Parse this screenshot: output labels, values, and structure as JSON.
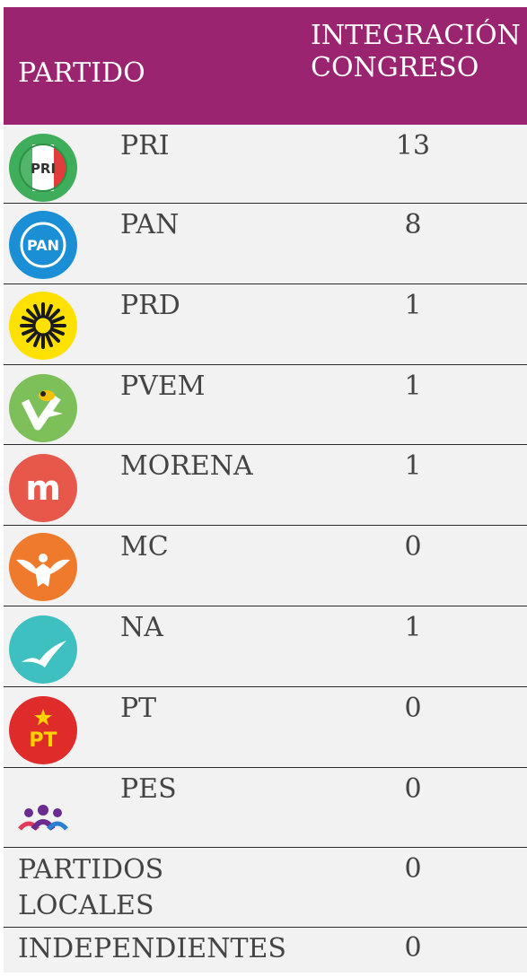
{
  "header": {
    "party": "PARTIDO",
    "integration_line1": "INTEGRACIÓN",
    "integration_line2": "CONGRESO"
  },
  "colors": {
    "header_bg": "#9b2470",
    "row_bg": "#f2f2f2",
    "text": "#444444"
  },
  "rows": [
    {
      "party": "PRI",
      "seats": "13",
      "icon": "pri-logo-icon"
    },
    {
      "party": "PAN",
      "seats": "8",
      "icon": "pan-logo-icon"
    },
    {
      "party": "PRD",
      "seats": "1",
      "icon": "prd-logo-icon"
    },
    {
      "party": "PVEM",
      "seats": "1",
      "icon": "pvem-logo-icon"
    },
    {
      "party": "MORENA",
      "seats": "1",
      "icon": "morena-logo-icon"
    },
    {
      "party": "MC",
      "seats": "0",
      "icon": "mc-logo-icon"
    },
    {
      "party": "NA",
      "seats": "1",
      "icon": "na-logo-icon"
    },
    {
      "party": "PT",
      "seats": "0",
      "icon": "pt-logo-icon"
    },
    {
      "party": "PES",
      "seats": "0",
      "icon": "pes-logo-icon"
    },
    {
      "party": "PARTIDOS LOCALES",
      "seats": "0"
    },
    {
      "party": "INDEPENDIENTES",
      "seats": "0"
    }
  ],
  "logo_text": {
    "pri": "PRI",
    "pan": "PAN",
    "morena": "m",
    "pt": "PT"
  }
}
